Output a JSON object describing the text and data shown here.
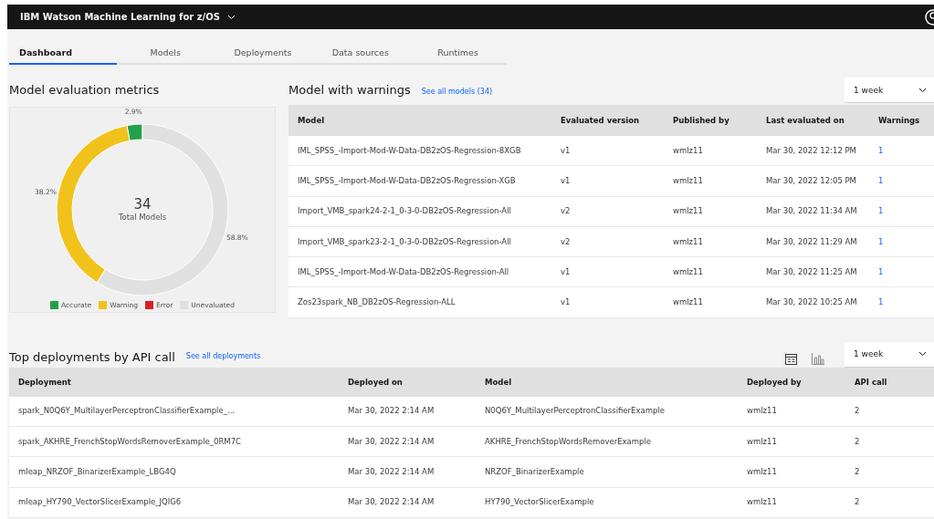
{
  "header": {
    "title": "IBM Watson Machine Learning for z/OS"
  },
  "tabs": [
    {
      "label": "Dashboard",
      "selected": true
    },
    {
      "label": "Models",
      "selected": false
    },
    {
      "label": "Deployments",
      "selected": false
    },
    {
      "label": "Data sources",
      "selected": false
    },
    {
      "label": "Runtimes",
      "selected": false
    }
  ],
  "metrics": {
    "title": "Model evaluation metrics",
    "total": "34",
    "total_label": "Total Models",
    "chart_data": {
      "type": "donut",
      "categories": [
        "Accurate",
        "Warning",
        "Error",
        "Unevaluated"
      ],
      "values": [
        2.9,
        38.2,
        0,
        58.8
      ],
      "colors": [
        "#24a148",
        "#f1c21b",
        "#da1e28",
        "#e0e0e0"
      ],
      "value_labels": [
        "2.9%",
        "38.2%",
        null,
        "58.8%"
      ]
    }
  },
  "warnings": {
    "title": "Model with warnings",
    "link": "See all models (34)",
    "period": "1 week",
    "columns": [
      "Model",
      "Evaluated version",
      "Published by",
      "Last evaluated on",
      "Warnings"
    ],
    "rows": [
      [
        "IML_SPSS_-Import-Mod-W-Data-DB2zOS-Regression-8XGB",
        "v1",
        "wmlz11",
        "Mar 30, 2022 12:12 PM",
        "1"
      ],
      [
        "IML_SPSS_-Import-Mod-W-Data-DB2zOS-Regression-XGB",
        "v1",
        "wmlz11",
        "Mar 30, 2022 12:05 PM",
        "1"
      ],
      [
        "Import_VMB_spark24-2-1_0-3-0-DB2zOS-Regression-All",
        "v2",
        "wmlz11",
        "Mar 30, 2022 11:34 AM",
        "1"
      ],
      [
        "Import_VMB_spark23-2-1_0-3-0-DB2zOS-Regression-All",
        "v2",
        "wmlz11",
        "Mar 30, 2022 11:29 AM",
        "1"
      ],
      [
        "IML_SPSS_-Import-Mod-W-Data-DB2zOS-Regression-All",
        "v1",
        "wmlz11",
        "Mar 30, 2022 11:25 AM",
        "1"
      ],
      [
        "Zos23spark_NB_DB2zOS-Regression-ALL",
        "v1",
        "wmlz11",
        "Mar 30, 2022 10:25 AM",
        "1"
      ]
    ]
  },
  "deployments": {
    "title": "Top deployments by API call",
    "link": "See all deployments",
    "period": "1 week",
    "columns": [
      "Deployment",
      "Deployed on",
      "Model",
      "Deployed by",
      "API call"
    ],
    "rows": [
      [
        "spark_N0Q6Y_MultilayerPerceptronClassifierExample_...",
        "Mar 30, 2022 2:14 AM",
        "N0Q6Y_MultilayerPerceptronClassifierExample",
        "wmlz11",
        "2"
      ],
      [
        "spark_AKHRE_FrenchStopWordsRemoverExample_0RM7C",
        "Mar 30, 2022 2:14 AM",
        "AKHRE_FrenchStopWordsRemoverExample",
        "wmlz11",
        "2"
      ],
      [
        "mleap_NRZOF_BinarizerExample_LBG4Q",
        "Mar 30, 2022 2:14 AM",
        "NRZOF_BinarizerExample",
        "wmlz11",
        "2"
      ],
      [
        "mleap_HY790_VectorSlicerExample_JQIG6",
        "Mar 30, 2022 2:14 AM",
        "HY790_VectorSlicerExample",
        "wmlz11",
        "2"
      ]
    ]
  }
}
